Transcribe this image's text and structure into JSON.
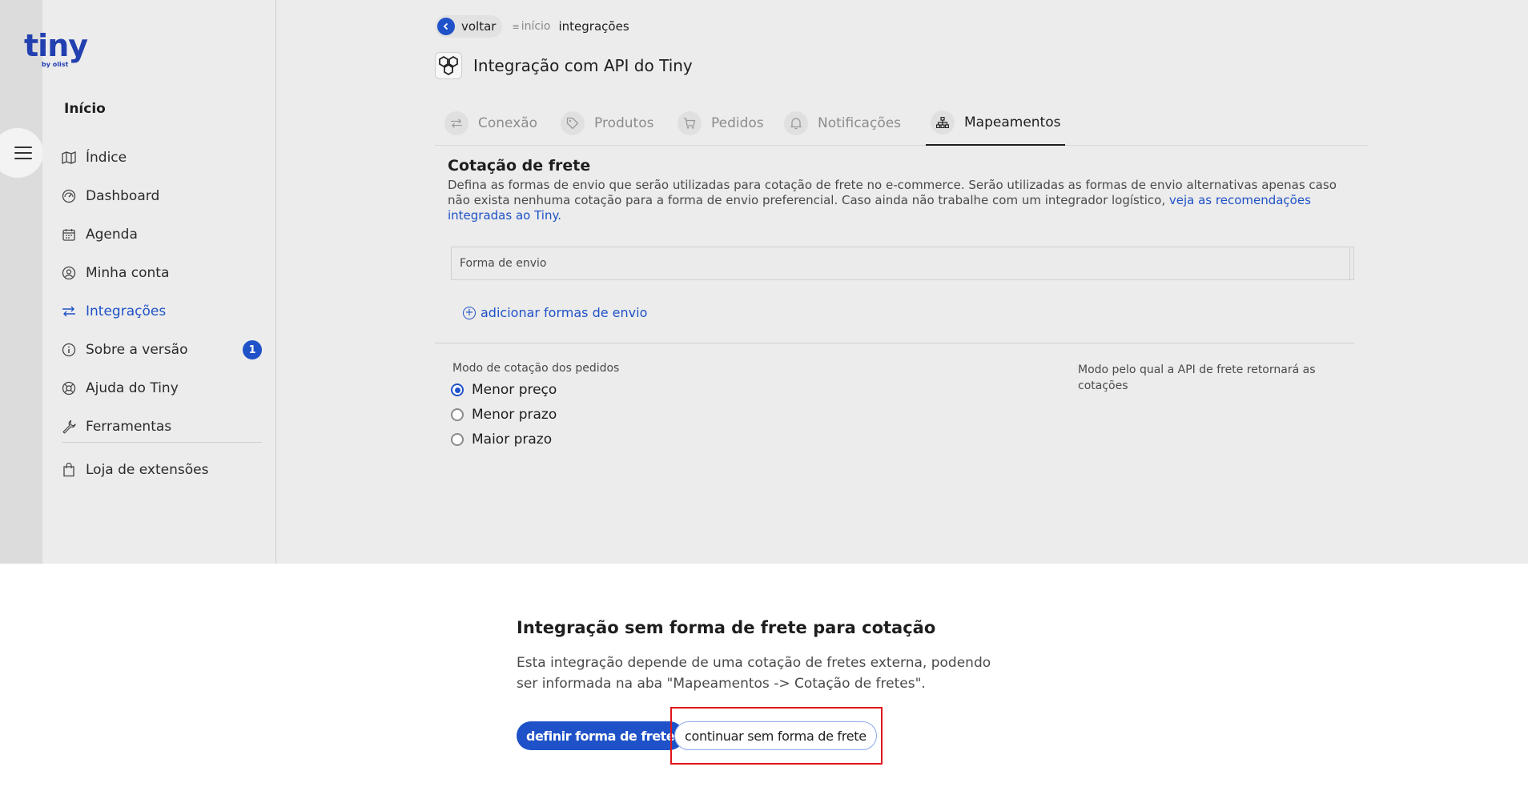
{
  "app": {
    "logo_text": "tiny",
    "logo_sub": "by olist"
  },
  "sidebar": {
    "section_title": "Início",
    "items": [
      {
        "label": "Índice",
        "icon": "map-icon",
        "active": false
      },
      {
        "label": "Dashboard",
        "icon": "gauge-icon",
        "active": false
      },
      {
        "label": "Agenda",
        "icon": "calendar-icon",
        "active": false
      },
      {
        "label": "Minha conta",
        "icon": "user-circle-icon",
        "active": false
      },
      {
        "label": "Integrações",
        "icon": "swap-arrows-icon",
        "active": true
      },
      {
        "label": "Sobre a versão",
        "icon": "info-icon",
        "active": false,
        "badge": "1"
      },
      {
        "label": "Ajuda do Tiny",
        "icon": "lifebuoy-icon",
        "active": false
      },
      {
        "label": "Ferramentas",
        "icon": "wrench-icon",
        "active": false
      },
      {
        "label": "Loja de extensões",
        "icon": "shopping-bag-icon",
        "active": false
      }
    ]
  },
  "breadcrumb": {
    "back_label": "voltar",
    "home_label": "início",
    "current_label": "integrações"
  },
  "page": {
    "title": "Integração com API do Tiny"
  },
  "tabs": [
    {
      "label": "Conexão",
      "icon": "swap-arrows-icon",
      "active": false
    },
    {
      "label": "Produtos",
      "icon": "tag-icon",
      "active": false
    },
    {
      "label": "Pedidos",
      "icon": "cart-icon",
      "active": false
    },
    {
      "label": "Notificações",
      "icon": "bell-icon",
      "active": false
    },
    {
      "label": "Mapeamentos",
      "icon": "hierarchy-icon",
      "active": true
    }
  ],
  "freight": {
    "title": "Cotação de frete",
    "description": "Defina as formas de envio que serão utilizadas para cotação de frete no e-commerce. Serão utilizadas as formas de envio alternativas apenas caso não exista nenhuma cotação para a forma de envio preferencial. Caso ainda não trabalhe com um integrador logístico, ",
    "description_link": "veja as recomendações integradas ao Tiny.",
    "table_header": "Forma de envio",
    "add_label": "adicionar formas de envio"
  },
  "quote_mode": {
    "label": "Modo de cotação dos pedidos",
    "options": [
      {
        "label": "Menor preço",
        "checked": true
      },
      {
        "label": "Menor prazo",
        "checked": false
      },
      {
        "label": "Maior prazo",
        "checked": false
      }
    ],
    "help": "Modo pelo qual a API de frete retornará as cotações"
  },
  "notice": {
    "title": "Integração sem forma de frete para cotação",
    "body": "Esta integração depende de uma cotação de fretes externa, podendo ser informada na aba \"Mapeamentos -> Cotação de fretes\".",
    "primary_button": "definir forma de frete",
    "secondary_button": "continuar sem forma de frete"
  },
  "colors": {
    "accent": "#1f52c8",
    "highlight": "#e0161b",
    "dimmed_bg": "#ececec"
  }
}
